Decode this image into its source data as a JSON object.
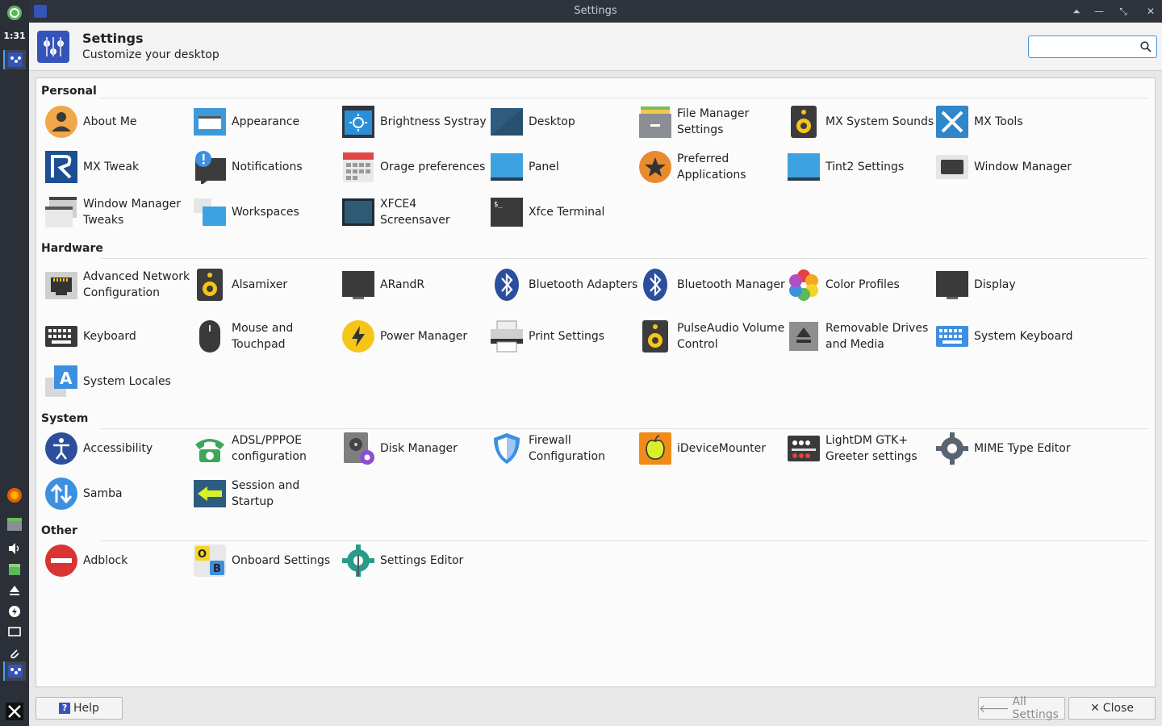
{
  "taskbar": {
    "clock": "1:31"
  },
  "window": {
    "title": "Settings"
  },
  "header": {
    "title": "Settings",
    "subtitle": "Customize your desktop",
    "search_value": ""
  },
  "sections": {
    "personal": "Personal",
    "hardware": "Hardware",
    "system": "System",
    "other": "Other"
  },
  "personal": [
    "About Me",
    "Appearance",
    "Brightness Systray",
    "Desktop",
    "File Manager Settings",
    "MX System Sounds",
    "MX Tools",
    "MX Tweak",
    "Notifications",
    "Orage preferences",
    "Panel",
    "Preferred Applications",
    "Tint2 Settings",
    "Window Manager",
    "Window Manager Tweaks",
    "Workspaces",
    "XFCE4 Screensaver",
    "Xfce Terminal"
  ],
  "hardware": [
    "Advanced Network Configuration",
    "Alsamixer",
    "ARandR",
    "Bluetooth Adapters",
    "Bluetooth Manager",
    "Color Profiles",
    "Display",
    "Keyboard",
    "Mouse and Touchpad",
    "Power Manager",
    "Print Settings",
    "PulseAudio Volume Control",
    "Removable Drives and Media",
    "System Keyboard",
    "System Locales"
  ],
  "system": [
    "Accessibility",
    "ADSL/PPPOE configuration",
    "Disk Manager",
    "Firewall Configuration",
    "iDeviceMounter",
    "LightDM GTK+ Greeter settings",
    "MIME Type Editor",
    "Samba",
    "Session and Startup"
  ],
  "other": [
    "Adblock",
    "Onboard Settings",
    "Settings Editor"
  ],
  "footer": {
    "help": "Help",
    "all_settings": "All Settings",
    "close": "Close"
  },
  "colors": {
    "accent": "#3553b8",
    "selection": "#4a90d9"
  }
}
